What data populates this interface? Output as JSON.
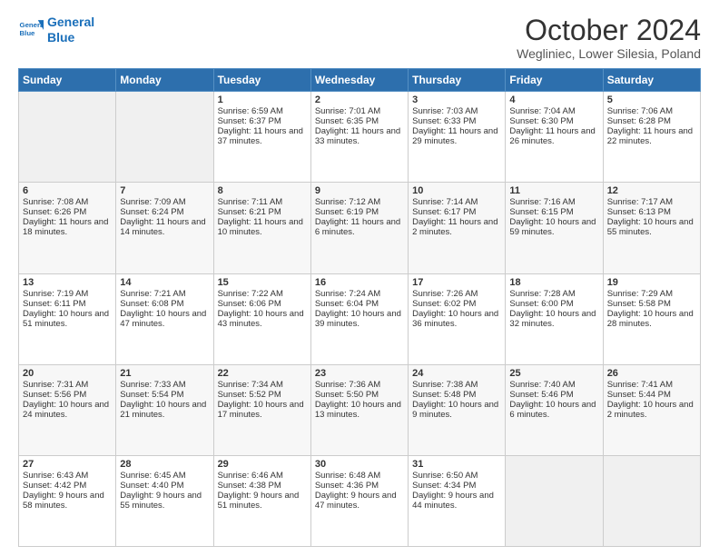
{
  "header": {
    "logo_line1": "General",
    "logo_line2": "Blue",
    "title": "October 2024",
    "subtitle": "Wegliniec, Lower Silesia, Poland"
  },
  "days_of_week": [
    "Sunday",
    "Monday",
    "Tuesday",
    "Wednesday",
    "Thursday",
    "Friday",
    "Saturday"
  ],
  "weeks": [
    [
      {
        "day": "",
        "sunrise": "",
        "sunset": "",
        "daylight": ""
      },
      {
        "day": "",
        "sunrise": "",
        "sunset": "",
        "daylight": ""
      },
      {
        "day": "1",
        "sunrise": "Sunrise: 6:59 AM",
        "sunset": "Sunset: 6:37 PM",
        "daylight": "Daylight: 11 hours and 37 minutes."
      },
      {
        "day": "2",
        "sunrise": "Sunrise: 7:01 AM",
        "sunset": "Sunset: 6:35 PM",
        "daylight": "Daylight: 11 hours and 33 minutes."
      },
      {
        "day": "3",
        "sunrise": "Sunrise: 7:03 AM",
        "sunset": "Sunset: 6:33 PM",
        "daylight": "Daylight: 11 hours and 29 minutes."
      },
      {
        "day": "4",
        "sunrise": "Sunrise: 7:04 AM",
        "sunset": "Sunset: 6:30 PM",
        "daylight": "Daylight: 11 hours and 26 minutes."
      },
      {
        "day": "5",
        "sunrise": "Sunrise: 7:06 AM",
        "sunset": "Sunset: 6:28 PM",
        "daylight": "Daylight: 11 hours and 22 minutes."
      }
    ],
    [
      {
        "day": "6",
        "sunrise": "Sunrise: 7:08 AM",
        "sunset": "Sunset: 6:26 PM",
        "daylight": "Daylight: 11 hours and 18 minutes."
      },
      {
        "day": "7",
        "sunrise": "Sunrise: 7:09 AM",
        "sunset": "Sunset: 6:24 PM",
        "daylight": "Daylight: 11 hours and 14 minutes."
      },
      {
        "day": "8",
        "sunrise": "Sunrise: 7:11 AM",
        "sunset": "Sunset: 6:21 PM",
        "daylight": "Daylight: 11 hours and 10 minutes."
      },
      {
        "day": "9",
        "sunrise": "Sunrise: 7:12 AM",
        "sunset": "Sunset: 6:19 PM",
        "daylight": "Daylight: 11 hours and 6 minutes."
      },
      {
        "day": "10",
        "sunrise": "Sunrise: 7:14 AM",
        "sunset": "Sunset: 6:17 PM",
        "daylight": "Daylight: 11 hours and 2 minutes."
      },
      {
        "day": "11",
        "sunrise": "Sunrise: 7:16 AM",
        "sunset": "Sunset: 6:15 PM",
        "daylight": "Daylight: 10 hours and 59 minutes."
      },
      {
        "day": "12",
        "sunrise": "Sunrise: 7:17 AM",
        "sunset": "Sunset: 6:13 PM",
        "daylight": "Daylight: 10 hours and 55 minutes."
      }
    ],
    [
      {
        "day": "13",
        "sunrise": "Sunrise: 7:19 AM",
        "sunset": "Sunset: 6:11 PM",
        "daylight": "Daylight: 10 hours and 51 minutes."
      },
      {
        "day": "14",
        "sunrise": "Sunrise: 7:21 AM",
        "sunset": "Sunset: 6:08 PM",
        "daylight": "Daylight: 10 hours and 47 minutes."
      },
      {
        "day": "15",
        "sunrise": "Sunrise: 7:22 AM",
        "sunset": "Sunset: 6:06 PM",
        "daylight": "Daylight: 10 hours and 43 minutes."
      },
      {
        "day": "16",
        "sunrise": "Sunrise: 7:24 AM",
        "sunset": "Sunset: 6:04 PM",
        "daylight": "Daylight: 10 hours and 39 minutes."
      },
      {
        "day": "17",
        "sunrise": "Sunrise: 7:26 AM",
        "sunset": "Sunset: 6:02 PM",
        "daylight": "Daylight: 10 hours and 36 minutes."
      },
      {
        "day": "18",
        "sunrise": "Sunrise: 7:28 AM",
        "sunset": "Sunset: 6:00 PM",
        "daylight": "Daylight: 10 hours and 32 minutes."
      },
      {
        "day": "19",
        "sunrise": "Sunrise: 7:29 AM",
        "sunset": "Sunset: 5:58 PM",
        "daylight": "Daylight: 10 hours and 28 minutes."
      }
    ],
    [
      {
        "day": "20",
        "sunrise": "Sunrise: 7:31 AM",
        "sunset": "Sunset: 5:56 PM",
        "daylight": "Daylight: 10 hours and 24 minutes."
      },
      {
        "day": "21",
        "sunrise": "Sunrise: 7:33 AM",
        "sunset": "Sunset: 5:54 PM",
        "daylight": "Daylight: 10 hours and 21 minutes."
      },
      {
        "day": "22",
        "sunrise": "Sunrise: 7:34 AM",
        "sunset": "Sunset: 5:52 PM",
        "daylight": "Daylight: 10 hours and 17 minutes."
      },
      {
        "day": "23",
        "sunrise": "Sunrise: 7:36 AM",
        "sunset": "Sunset: 5:50 PM",
        "daylight": "Daylight: 10 hours and 13 minutes."
      },
      {
        "day": "24",
        "sunrise": "Sunrise: 7:38 AM",
        "sunset": "Sunset: 5:48 PM",
        "daylight": "Daylight: 10 hours and 9 minutes."
      },
      {
        "day": "25",
        "sunrise": "Sunrise: 7:40 AM",
        "sunset": "Sunset: 5:46 PM",
        "daylight": "Daylight: 10 hours and 6 minutes."
      },
      {
        "day": "26",
        "sunrise": "Sunrise: 7:41 AM",
        "sunset": "Sunset: 5:44 PM",
        "daylight": "Daylight: 10 hours and 2 minutes."
      }
    ],
    [
      {
        "day": "27",
        "sunrise": "Sunrise: 6:43 AM",
        "sunset": "Sunset: 4:42 PM",
        "daylight": "Daylight: 9 hours and 58 minutes."
      },
      {
        "day": "28",
        "sunrise": "Sunrise: 6:45 AM",
        "sunset": "Sunset: 4:40 PM",
        "daylight": "Daylight: 9 hours and 55 minutes."
      },
      {
        "day": "29",
        "sunrise": "Sunrise: 6:46 AM",
        "sunset": "Sunset: 4:38 PM",
        "daylight": "Daylight: 9 hours and 51 minutes."
      },
      {
        "day": "30",
        "sunrise": "Sunrise: 6:48 AM",
        "sunset": "Sunset: 4:36 PM",
        "daylight": "Daylight: 9 hours and 47 minutes."
      },
      {
        "day": "31",
        "sunrise": "Sunrise: 6:50 AM",
        "sunset": "Sunset: 4:34 PM",
        "daylight": "Daylight: 9 hours and 44 minutes."
      },
      {
        "day": "",
        "sunrise": "",
        "sunset": "",
        "daylight": ""
      },
      {
        "day": "",
        "sunrise": "",
        "sunset": "",
        "daylight": ""
      }
    ]
  ]
}
